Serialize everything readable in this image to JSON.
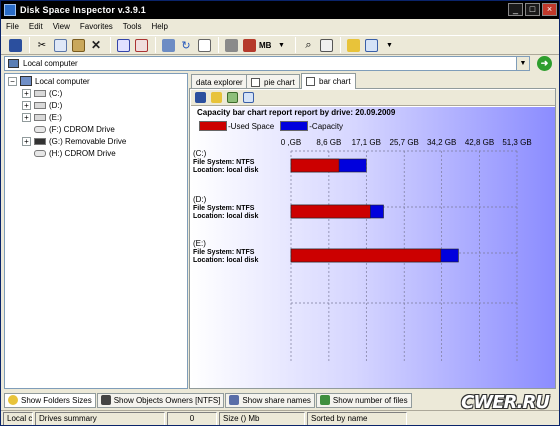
{
  "window": {
    "title": "Disk Space Inspector v.3.9.1"
  },
  "menu": [
    "File",
    "Edit",
    "View",
    "Favorites",
    "Tools",
    "Help"
  ],
  "toolbar": {
    "units_label": "MB"
  },
  "address": {
    "value": "Local computer"
  },
  "tree": {
    "root": "Local computer",
    "items": [
      {
        "label": "(C:)",
        "type": "hdd",
        "expandable": true
      },
      {
        "label": "(D:)",
        "type": "hdd",
        "expandable": true
      },
      {
        "label": "(E:)",
        "type": "hdd",
        "expandable": true
      },
      {
        "label": "(F:)  CDROM Drive",
        "type": "cdrom",
        "expandable": false
      },
      {
        "label": "(G:)  Removable Drive",
        "type": "removable",
        "expandable": true
      },
      {
        "label": "(H:)  CDROM Drive",
        "type": "cdrom",
        "expandable": false
      }
    ]
  },
  "tabs": [
    {
      "label": "data explorer",
      "active": false
    },
    {
      "label": "pie chart",
      "active": false
    },
    {
      "label": "bar chart",
      "active": true
    }
  ],
  "chart_data": {
    "type": "bar",
    "orientation": "horizontal",
    "title": "Capacity bar chart report report by drive: 20.09.2009",
    "x_tick_labels": [
      "0 ,GB",
      "8,6 GB",
      "17,1 GB",
      "25,7 GB",
      "34,2 GB",
      "42,8 GB",
      "51,3 GB"
    ],
    "x_ticks": [
      0,
      8.6,
      17.1,
      25.7,
      34.2,
      42.8,
      51.3
    ],
    "xlim": [
      0,
      51.3
    ],
    "grid": true,
    "legend_position": "top-left",
    "series": [
      {
        "name": "-Used Space",
        "color": "#cc0000"
      },
      {
        "name": "-Capacity",
        "color": "#0000dd"
      }
    ],
    "drives": [
      {
        "label": "(C:)",
        "fs": "File System: NTFS",
        "location": "Location: local disk",
        "used": 10.9,
        "capacity": 17.1
      },
      {
        "label": "(D:)",
        "fs": "File System: NTFS",
        "location": "Location: local disk",
        "used": 18.0,
        "capacity": 21.0
      },
      {
        "label": "(E:)",
        "fs": "File System: NTFS",
        "location": "Location: local disk",
        "used": 34.0,
        "capacity": 38.0
      }
    ]
  },
  "bottom_tabs": [
    {
      "label": "Show Folders Sizes",
      "active": true
    },
    {
      "label": "Show Objects Owners [NTFS]",
      "active": false
    },
    {
      "label": "Show share names",
      "active": false
    },
    {
      "label": "Show number of files",
      "active": false
    }
  ],
  "status": {
    "cell1": "Local co",
    "cell2": "Drives summary",
    "cell3": "0",
    "cell4": "Size () Mb",
    "cell5": "Sorted by name"
  },
  "watermark": {
    "text": "CWER.RU"
  },
  "colors": {
    "used": "#cc0000",
    "capacity": "#0000dd",
    "titlebar": "#000000"
  }
}
